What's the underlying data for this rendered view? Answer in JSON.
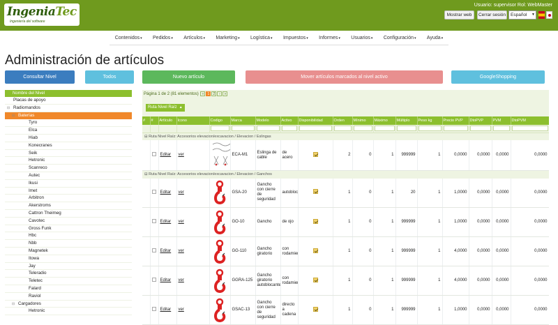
{
  "header": {
    "logo_main": "Ingenia",
    "logo_accent": "Tec",
    "logo_sub": "Ingeniería del software",
    "user": "Usuario: supervisor Rol: WebMaster",
    "btn_web": "Mostrar web",
    "btn_logout": "Cerrar sesión",
    "language": "Español"
  },
  "nav": [
    "Contenidos",
    "Pedidos",
    "Artículos",
    "Marketing",
    "Logística",
    "Impuestos",
    "Informes",
    "Usuarios",
    "Configuración",
    "Ayuda"
  ],
  "title": "Administración de artículos",
  "actions": {
    "consultar": "Consultar Nivel",
    "todos": "Todos",
    "nuevo": "Nuevo artículo",
    "mover": "Mover artículos marcados al nivel activo",
    "google": "GoogleShopping"
  },
  "tree": {
    "header": "Nombre del Nivel",
    "nodes": [
      {
        "label": "Placas de apoyo",
        "level": 0,
        "expander": ""
      },
      {
        "label": "Radiomandos",
        "level": 0,
        "expander": "⊟"
      },
      {
        "label": "Baterías",
        "level": 1,
        "expander": "⊟",
        "selected": true
      },
      {
        "label": "Tyro",
        "level": 2,
        "expander": ""
      },
      {
        "label": "Elca",
        "level": 2,
        "expander": ""
      },
      {
        "label": "Hiab",
        "level": 2,
        "expander": ""
      },
      {
        "label": "Konecranes",
        "level": 2,
        "expander": ""
      },
      {
        "label": "Seik",
        "level": 2,
        "expander": ""
      },
      {
        "label": "Hetronic",
        "level": 2,
        "expander": ""
      },
      {
        "label": "Scanreco",
        "level": 2,
        "expander": ""
      },
      {
        "label": "Autec",
        "level": 2,
        "expander": ""
      },
      {
        "label": "Ikusi",
        "level": 2,
        "expander": ""
      },
      {
        "label": "Imet",
        "level": 2,
        "expander": ""
      },
      {
        "label": "Arbitron",
        "level": 2,
        "expander": ""
      },
      {
        "label": "Akerstroms",
        "level": 2,
        "expander": ""
      },
      {
        "label": "Cattron Theimeg",
        "level": 2,
        "expander": ""
      },
      {
        "label": "Cavotec",
        "level": 2,
        "expander": ""
      },
      {
        "label": "Gross Funk",
        "level": 2,
        "expander": ""
      },
      {
        "label": "Hbc",
        "level": 2,
        "expander": ""
      },
      {
        "label": "Nbb",
        "level": 2,
        "expander": ""
      },
      {
        "label": "Magnetek",
        "level": 2,
        "expander": ""
      },
      {
        "label": "Itowa",
        "level": 2,
        "expander": ""
      },
      {
        "label": "Jay",
        "level": 2,
        "expander": ""
      },
      {
        "label": "Teleradio",
        "level": 2,
        "expander": ""
      },
      {
        "label": "Teletec",
        "level": 2,
        "expander": ""
      },
      {
        "label": "Falard",
        "level": 2,
        "expander": ""
      },
      {
        "label": "Raviol",
        "level": 2,
        "expander": ""
      },
      {
        "label": "Cargadores",
        "level": 1,
        "expander": "⊟"
      },
      {
        "label": "Hetronic",
        "level": 2,
        "expander": ""
      }
    ]
  },
  "grid": {
    "pager_text": "Página 1 de 2 (81 elementos)",
    "pages": [
      "1",
      "2"
    ],
    "group_chip": "Ruta Nivel Raíz",
    "columns": [
      "#",
      "#",
      "Artículo",
      "Icono",
      "Codigo",
      "Marca",
      "Modelo",
      "Activo",
      "Disponibilidad",
      "Orden",
      "Mínimo",
      "Máximo",
      "Múltiplo",
      "Peso kg",
      "Precio PVP",
      "DtoPVP",
      "PVM",
      "DtoPVM"
    ],
    "edit_label": "Editar",
    "view_label": "ver",
    "groups": [
      {
        "title": "Ruta Nivel Raíz: Accesorios elevacion/excavacion / Elevacion / Eslingas",
        "rows": [
          {
            "codigo": "ECA-M1",
            "marca": "Eslinga de cable",
            "modelo": "de acero",
            "disp": "2",
            "orden": "0",
            "min": "1",
            "max": "999999",
            "mult": "1",
            "peso": "0,0000",
            "pvp": "0,0000",
            "dtopvp": "0,0000",
            "pvm": "0,0000",
            "dtopvm": "0,00",
            "icon": "sling-icon"
          }
        ]
      },
      {
        "title": "Ruta Nivel Raíz: Accesorios elevacion/excavacion / Elevacion / Ganchos",
        "rows": [
          {
            "codigo": "GSA-20",
            "marca": "Gancho con cierre de seguridad",
            "modelo": "autoblocante",
            "disp": "1",
            "orden": "0",
            "min": "1",
            "max": "20",
            "mult": "1",
            "peso": "1,0000",
            "pvp": "0,0000",
            "dtopvp": "0,0000",
            "pvm": "0,0000",
            "dtopvm": "0,00",
            "icon": "red-hook-icon"
          },
          {
            "codigo": "GO-10",
            "marca": "Gancho",
            "modelo": "de ojo",
            "disp": "1",
            "orden": "0",
            "min": "1",
            "max": "999999",
            "mult": "1",
            "peso": "1,0000",
            "pvp": "0,0000",
            "dtopvp": "0,0000",
            "pvm": "0,0000",
            "dtopvm": "0,00",
            "icon": "red-hook-icon"
          },
          {
            "codigo": "GG-110",
            "marca": "Gancho giratorio",
            "modelo": "con rodamiento",
            "disp": "1",
            "orden": "0",
            "min": "1",
            "max": "999999",
            "mult": "1",
            "peso": "4,0000",
            "pvp": "0,0000",
            "dtopvp": "0,0000",
            "pvm": "0,0000",
            "dtopvm": "0,00",
            "icon": "red-hook-icon"
          },
          {
            "codigo": "GGRA-125",
            "marca": "Gancho giratorio autoblocante",
            "modelo": "con rodamiento",
            "disp": "1",
            "orden": "0",
            "min": "1",
            "max": "999999",
            "mult": "1",
            "peso": "4,0000",
            "pvp": "0,0000",
            "dtopvp": "0,0000",
            "pvm": "0,0000",
            "dtopvm": "0,00",
            "icon": "red-hook-icon"
          },
          {
            "codigo": "GSAC-13",
            "marca": "Gancho con cierre de seguridad",
            "modelo": "directo a cadena",
            "disp": "1",
            "orden": "0",
            "min": "1",
            "max": "999999",
            "mult": "1",
            "peso": "1,0000",
            "pvp": "0,0000",
            "dtopvp": "0,0000",
            "pvm": "0,0000",
            "dtopvm": "0,00",
            "icon": "red-hook-icon"
          }
        ]
      }
    ]
  }
}
